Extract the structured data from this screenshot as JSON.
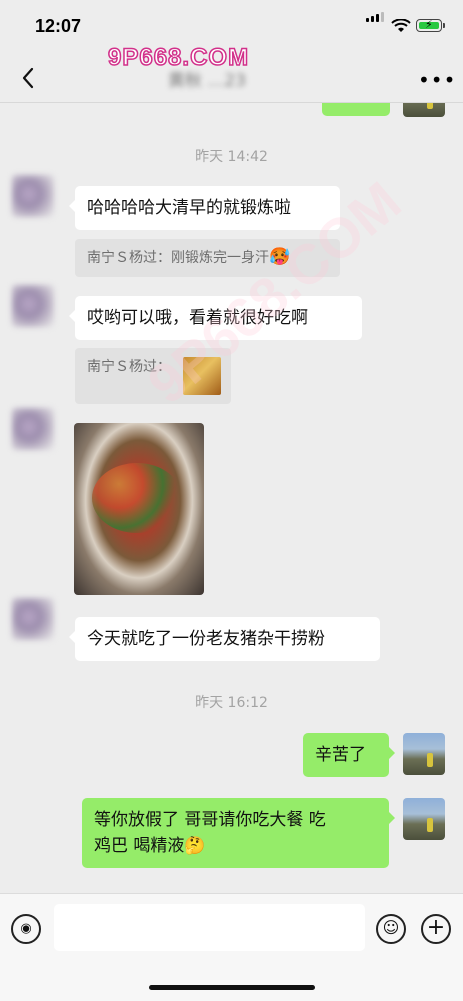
{
  "status": {
    "time": "12:07"
  },
  "header": {
    "title": "黄秋 …23",
    "watermark": "9P668.COM"
  },
  "messages": {
    "ts1": "昨天 14:42",
    "m1": "哈哈哈哈大清早的就锻炼啦",
    "q1_prefix": "南宁Ｓ杨过：刚锻炼完一身汗",
    "q1_emoji": "🥵",
    "m2": "哎哟可以哦，看着就很好吃啊",
    "q2": "南宁Ｓ杨过：",
    "m3": "今天就吃了一份老友猪杂干捞粉",
    "ts2": "昨天 16:12",
    "m4": "辛苦了",
    "m5_line1": "等你放假了 哥哥请你吃大餐 吃",
    "m5_line2": "鸡巴 喝精液",
    "m5_emoji": "🤔"
  },
  "input": {
    "placeholder": ""
  },
  "icons": {
    "back": "chevron-left-icon",
    "more": "more-dots-icon",
    "voice": "voice-icon",
    "emoji": "emoji-icon",
    "plus": "plus-icon"
  },
  "colors": {
    "outgoing_bubble": "#95ec69",
    "incoming_bubble": "#ffffff",
    "background": "#ededed",
    "watermark": "#d2308a"
  }
}
